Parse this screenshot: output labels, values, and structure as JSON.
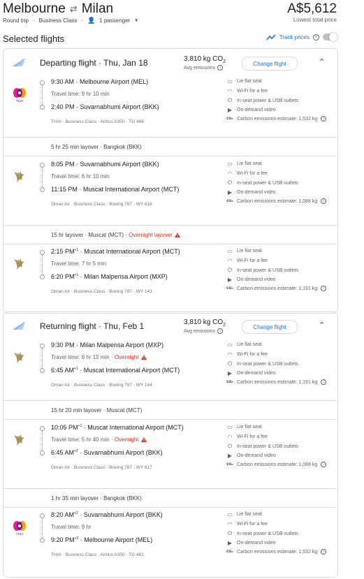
{
  "header": {
    "origin": "Melbourne",
    "destination": "Milan",
    "trip_type": "Round trip",
    "cabin": "Business Class",
    "passengers": "1 passenger",
    "price": "A$5,612",
    "price_note": "Lowest total price"
  },
  "selected_title": "Selected flights",
  "track_label": "Track prices",
  "colors": {
    "accent": "#1a73e8",
    "warning": "#d93025"
  },
  "departing": {
    "title": "Departing flight · Thu, Jan 18",
    "co2": "3,810 kg CO",
    "co2_sub": "Avg emissions",
    "change": "Change flight",
    "legs": [
      {
        "airline_icon": "thai-logo-icon",
        "dep_time": "9:30 AM",
        "dep_sup": "",
        "dep_airport": "Melbourne Airport (MEL)",
        "travel": "Travel time: 9 hr 10 min",
        "travel_flag": "",
        "arr_time": "2:40 PM",
        "arr_sup": "",
        "arr_airport": "Suvarnabhumi Airport (BKK)",
        "meta": "THAI · Business Class · Airbus A350 · TG 466",
        "amenities": [
          "Lie flat seat",
          "Wi-Fi for a fee",
          "In-seat power & USB outlets",
          "On-demand video",
          "Carbon emissions estimate: 1,532 kg"
        ]
      },
      {
        "airline_icon": "oman-air-logo-icon",
        "dep_time": "8:05 PM",
        "dep_sup": "",
        "dep_airport": "Suvarnabhumi Airport (BKK)",
        "travel": "Travel time: 6 hr 10 min",
        "travel_flag": "",
        "arr_time": "11:15 PM",
        "arr_sup": "",
        "arr_airport": "Muscat International Airport (MCT)",
        "meta": "Oman Air · Business Class · Boeing 787 · WY 816",
        "amenities": [
          "Lie flat seat",
          "Wi-Fi for a fee",
          "In-seat power & USB outlets",
          "On-demand video",
          "Carbon emissions estimate: 1,088 kg"
        ]
      },
      {
        "airline_icon": "oman-air-logo-icon",
        "dep_time": "2:15 PM",
        "dep_sup": "+1",
        "dep_airport": "Muscat International Airport (MCT)",
        "travel": "Travel time: 7 hr 5 min",
        "travel_flag": "",
        "arr_time": "6:20 PM",
        "arr_sup": "+1",
        "arr_airport": "Milan Malpensa Airport (MXP)",
        "meta": "Oman Air · Business Class · Boeing 787 · WY 143",
        "amenities": [
          "Lie flat seat",
          "Wi-Fi for a fee",
          "In-seat power & USB outlets",
          "On-demand video",
          "Carbon emissions estimate: 1,191 kg"
        ]
      }
    ],
    "layovers": [
      {
        "text": "5 hr 25 min layover · Bangkok (BKK)",
        "flag": ""
      },
      {
        "text": "15 hr layover · Muscat (MCT) · ",
        "flag": "Overnight layover"
      }
    ]
  },
  "returning": {
    "title": "Returning flight · Thu, Feb 1",
    "co2": "3,810 kg CO",
    "co2_sub": "Avg emissions",
    "change": "Change flight",
    "legs": [
      {
        "airline_icon": "oman-air-logo-icon",
        "dep_time": "9:30 PM",
        "dep_sup": "",
        "dep_airport": "Milan Malpensa Airport (MXP)",
        "travel": "Travel time: 6 hr 15 min · ",
        "travel_flag": "Overnight",
        "arr_time": "6:45 AM",
        "arr_sup": "+1",
        "arr_airport": "Muscat International Airport (MCT)",
        "meta": "Oman Air · Business Class · Boeing 787 · WY 144",
        "amenities": [
          "Lie flat seat",
          "Wi-Fi for a fee",
          "In-seat power & USB outlets",
          "On-demand video",
          "Carbon emissions estimate: 1,191 kg"
        ]
      },
      {
        "airline_icon": "oman-air-logo-icon",
        "dep_time": "10:05 PM",
        "dep_sup": "+1",
        "dep_airport": "Muscat International Airport (MCT)",
        "travel": "Travel time: 5 hr 40 min · ",
        "travel_flag": "Overnight",
        "arr_time": "6:45 AM",
        "arr_sup": "+2",
        "arr_airport": "Suvarnabhumi Airport (BKK)",
        "meta": "Oman Air · Business Class · Boeing 787 · WY 817",
        "amenities": [
          "Lie flat seat",
          "Wi-Fi for a fee",
          "In-seat power & USB outlets",
          "On-demand video",
          "Carbon emissions estimate: 1,088 kg"
        ]
      },
      {
        "airline_icon": "thai-logo-icon",
        "dep_time": "8:20 AM",
        "dep_sup": "+2",
        "dep_airport": "Suvarnabhumi Airport (BKK)",
        "travel": "Travel time: 9 hr",
        "travel_flag": "",
        "arr_time": "9:20 PM",
        "arr_sup": "+2",
        "arr_airport": "Melbourne Airport (MEL)",
        "meta": "THAI · Business Class · Airbus A350 · TG 461",
        "amenities": [
          "Lie flat seat",
          "Wi-Fi for a fee",
          "In-seat power & USB outlets",
          "On-demand video",
          "Carbon emissions estimate: 1,532 kg"
        ]
      }
    ],
    "layovers": [
      {
        "text": "15 hr 20 min layover · Muscat (MCT)",
        "flag": ""
      },
      {
        "text": "1 hr 35 min layover · Bangkok (BKK)",
        "flag": ""
      }
    ]
  }
}
